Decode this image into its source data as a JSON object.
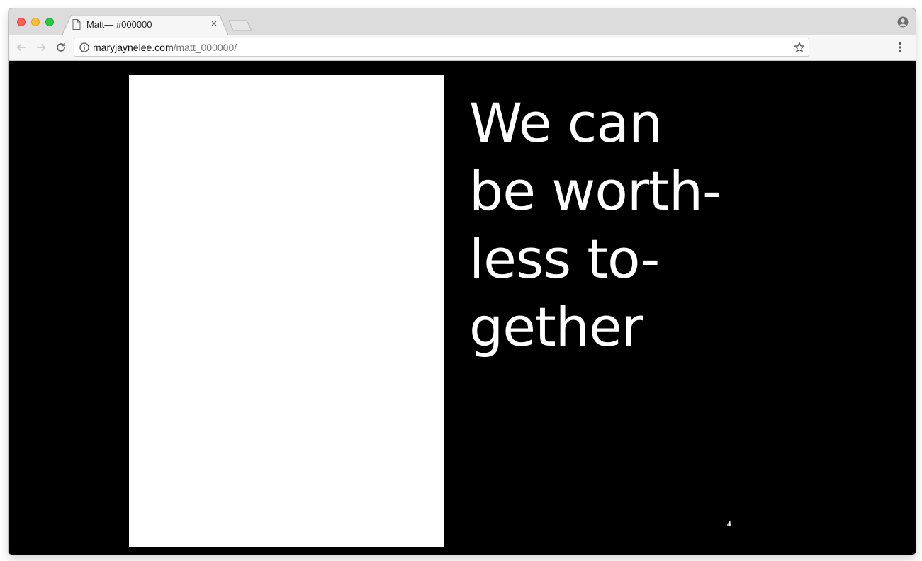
{
  "browser": {
    "tab": {
      "title": "Matt— #000000",
      "close_glyph": "×"
    },
    "address_bar": {
      "host": "maryjaynelee.com",
      "path": "/matt_000000/"
    },
    "icons": {
      "back": "back-arrow-icon",
      "forward": "forward-arrow-icon",
      "reload": "reload-icon",
      "info": "info-icon",
      "bookmark": "star-icon",
      "menu": "vertical-dots-menu-icon",
      "profile": "profile-icon",
      "tab_page": "document-icon"
    }
  },
  "page": {
    "headline_lines": [
      "We can",
      "be worth-",
      "less to-",
      "gether"
    ],
    "page_number": "4",
    "colors": {
      "background": "#000000",
      "panel": "#ffffff",
      "text": "#ffffff"
    }
  }
}
